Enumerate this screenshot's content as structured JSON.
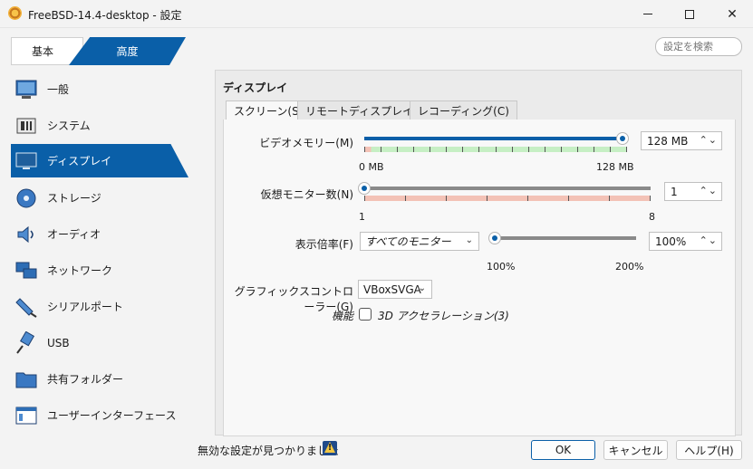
{
  "window": {
    "title": "FreeBSD-14.4-desktop - 設定",
    "icon": "virtualbox-icon"
  },
  "mode_tabs": {
    "basic": "基本",
    "advanced": "高度",
    "selected": "advanced"
  },
  "search": {
    "placeholder": "設定を検索"
  },
  "sidebar": {
    "items": [
      {
        "label": "一般",
        "icon": "general-icon"
      },
      {
        "label": "システム",
        "icon": "system-icon"
      },
      {
        "label": "ディスプレイ",
        "icon": "display-icon"
      },
      {
        "label": "ストレージ",
        "icon": "storage-icon"
      },
      {
        "label": "オーディオ",
        "icon": "audio-icon"
      },
      {
        "label": "ネットワーク",
        "icon": "network-icon"
      },
      {
        "label": "シリアルポート",
        "icon": "serial-port-icon"
      },
      {
        "label": "USB",
        "icon": "usb-icon"
      },
      {
        "label": "共有フォルダー",
        "icon": "shared-folder-icon"
      },
      {
        "label": "ユーザーインターフェース",
        "icon": "user-interface-icon"
      }
    ],
    "selected_index": 2
  },
  "section": {
    "title": "ディスプレイ",
    "tabs": [
      {
        "label": "スクリーン(S)"
      },
      {
        "label": "リモートディスプレイ(R)"
      },
      {
        "label": "レコーディング(C)"
      }
    ],
    "selected_tab": 0
  },
  "screen": {
    "video_memory": {
      "label": "ビデオメモリー(M)",
      "value": "128 MB",
      "min_label": "0 MB",
      "max_label": "128 MB",
      "fraction": 1.0
    },
    "monitors": {
      "label": "仮想モニター数(N)",
      "value": "1",
      "min_label": "1",
      "max_label": "8",
      "fraction": 0.0
    },
    "scale": {
      "label": "表示倍率(F)",
      "target": "すべてのモニター",
      "value": "100%",
      "min_label": "100%",
      "max_label": "200%",
      "fraction": 0.0
    },
    "graphics_controller": {
      "label": "グラフィックスコントローラー(G)",
      "value": "VBoxSVGA"
    },
    "features": {
      "label": "機能",
      "acceleration_3d": {
        "label": "3D アクセラレーション(3)",
        "checked": false
      }
    }
  },
  "footer": {
    "warning": "無効な設定が見つかりました",
    "ok": "OK",
    "cancel": "キャンセル",
    "help": "ヘルプ(H)"
  }
}
